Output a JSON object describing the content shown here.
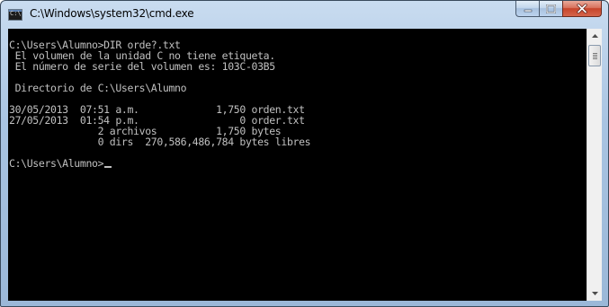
{
  "window": {
    "title": "C:\\Windows\\system32\\cmd.exe",
    "app_icon_text": "C:\\"
  },
  "console": {
    "lines": [
      "C:\\Users\\Alumno>DIR orde?.txt",
      " El volumen de la unidad C no tiene etiqueta.",
      " El número de serie del volumen es: 103C-03B5",
      "",
      " Directorio de C:\\Users\\Alumno",
      "",
      "30/05/2013  07:51 a.m.             1,750 orden.txt",
      "27/05/2013  01:54 p.m.                 0 order.txt",
      "               2 archivos          1,750 bytes",
      "               0 dirs  270,586,486,784 bytes libres",
      ""
    ],
    "prompt": "C:\\Users\\Alumno>"
  },
  "colors": {
    "console_bg": "#000000",
    "console_fg": "#c0c0c0",
    "close_button": "#c7442b"
  }
}
